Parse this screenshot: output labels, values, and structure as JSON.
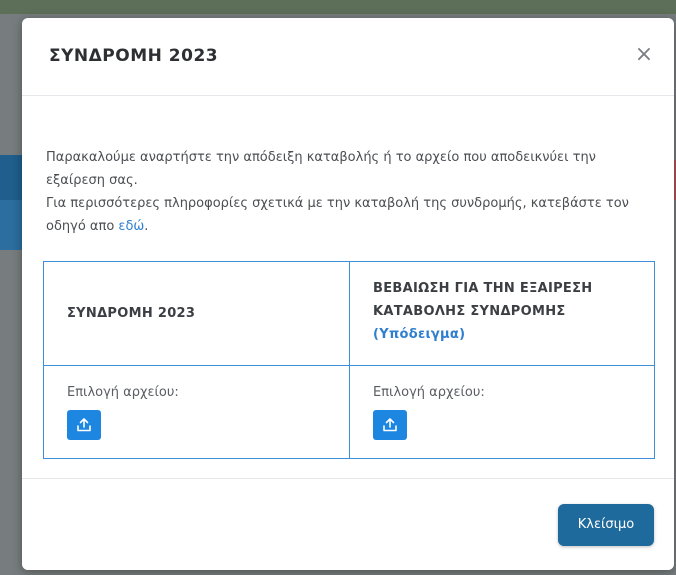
{
  "modal": {
    "title": "ΣΥΝΔΡΟΜΗ 2023",
    "close_icon": "×"
  },
  "intro": {
    "line1": "Παρακαλούμε αναρτήστε την απόδειξη καταβολής ή το αρχείο που αποδεικνύει την εξαίρεση σας.",
    "line2_prefix": "Για περισσότερες πληροφορίες σχετικά με την καταβολή της συνδρομής, κατεβάστε τον οδηγό απο ",
    "link_text": "εδώ",
    "line2_suffix": "."
  },
  "table": {
    "header_left": "ΣΥΝΔΡΟΜΗ 2023",
    "header_right": "ΒΕΒΑΙΩΣΗ ΓΙΑ ΤΗΝ ΕΞΑΙΡΕΣΗ ΚΑΤΑΒΟΛΗΣ ΣΥΝΔΡΟΜΗΣ",
    "header_right_link": "(Υπόδειγμα)",
    "file_label_left": "Επιλογή αρχείου:",
    "file_label_right": "Επιλογή αρχείου:",
    "upload_icon": "upload-icon"
  },
  "footer": {
    "close_label": "Κλείσιμο"
  },
  "colors": {
    "accent": "#1d86e0",
    "link": "#2f7fd0",
    "table_border": "#3c8fd8",
    "close_button": "#1f6a9c"
  }
}
